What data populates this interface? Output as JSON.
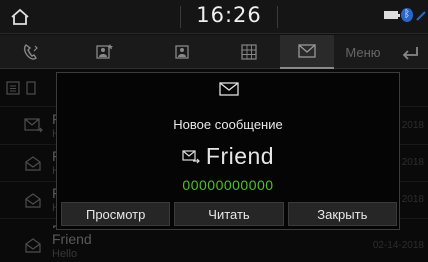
{
  "status": {
    "time": "16:26",
    "icons": [
      "home-icon",
      "battery-icon",
      "bluetooth-icon",
      "signal-icon"
    ]
  },
  "tabs": [
    {
      "icon": "call-history-icon",
      "selected": false
    },
    {
      "icon": "favorites-icon",
      "selected": false
    },
    {
      "icon": "contacts-icon",
      "selected": false
    },
    {
      "icon": "dial-pad-icon",
      "selected": false
    },
    {
      "icon": "messages-icon",
      "selected": true
    }
  ],
  "menu_label": "Меню",
  "list": {
    "rows": [
      {
        "name": "F",
        "sub": "H",
        "date": "2018"
      },
      {
        "name": "F",
        "sub": "H",
        "date": "2018"
      },
      {
        "name": "F",
        "sub": "H",
        "date": "2018"
      },
      {
        "name": "F",
        "sub": "H",
        "date": "2018"
      },
      {
        "name": "Friend",
        "sub": "Hello",
        "date": "02-14-2018"
      }
    ]
  },
  "popup": {
    "title": "Новое сообщение",
    "sender": "Friend",
    "number": "00000000000",
    "buttons": {
      "view": "Просмотр",
      "read": "Читать",
      "close": "Закрыть"
    }
  },
  "colors": {
    "number": "#4fbf2a",
    "accent_bluetooth": "#2a66c9"
  }
}
